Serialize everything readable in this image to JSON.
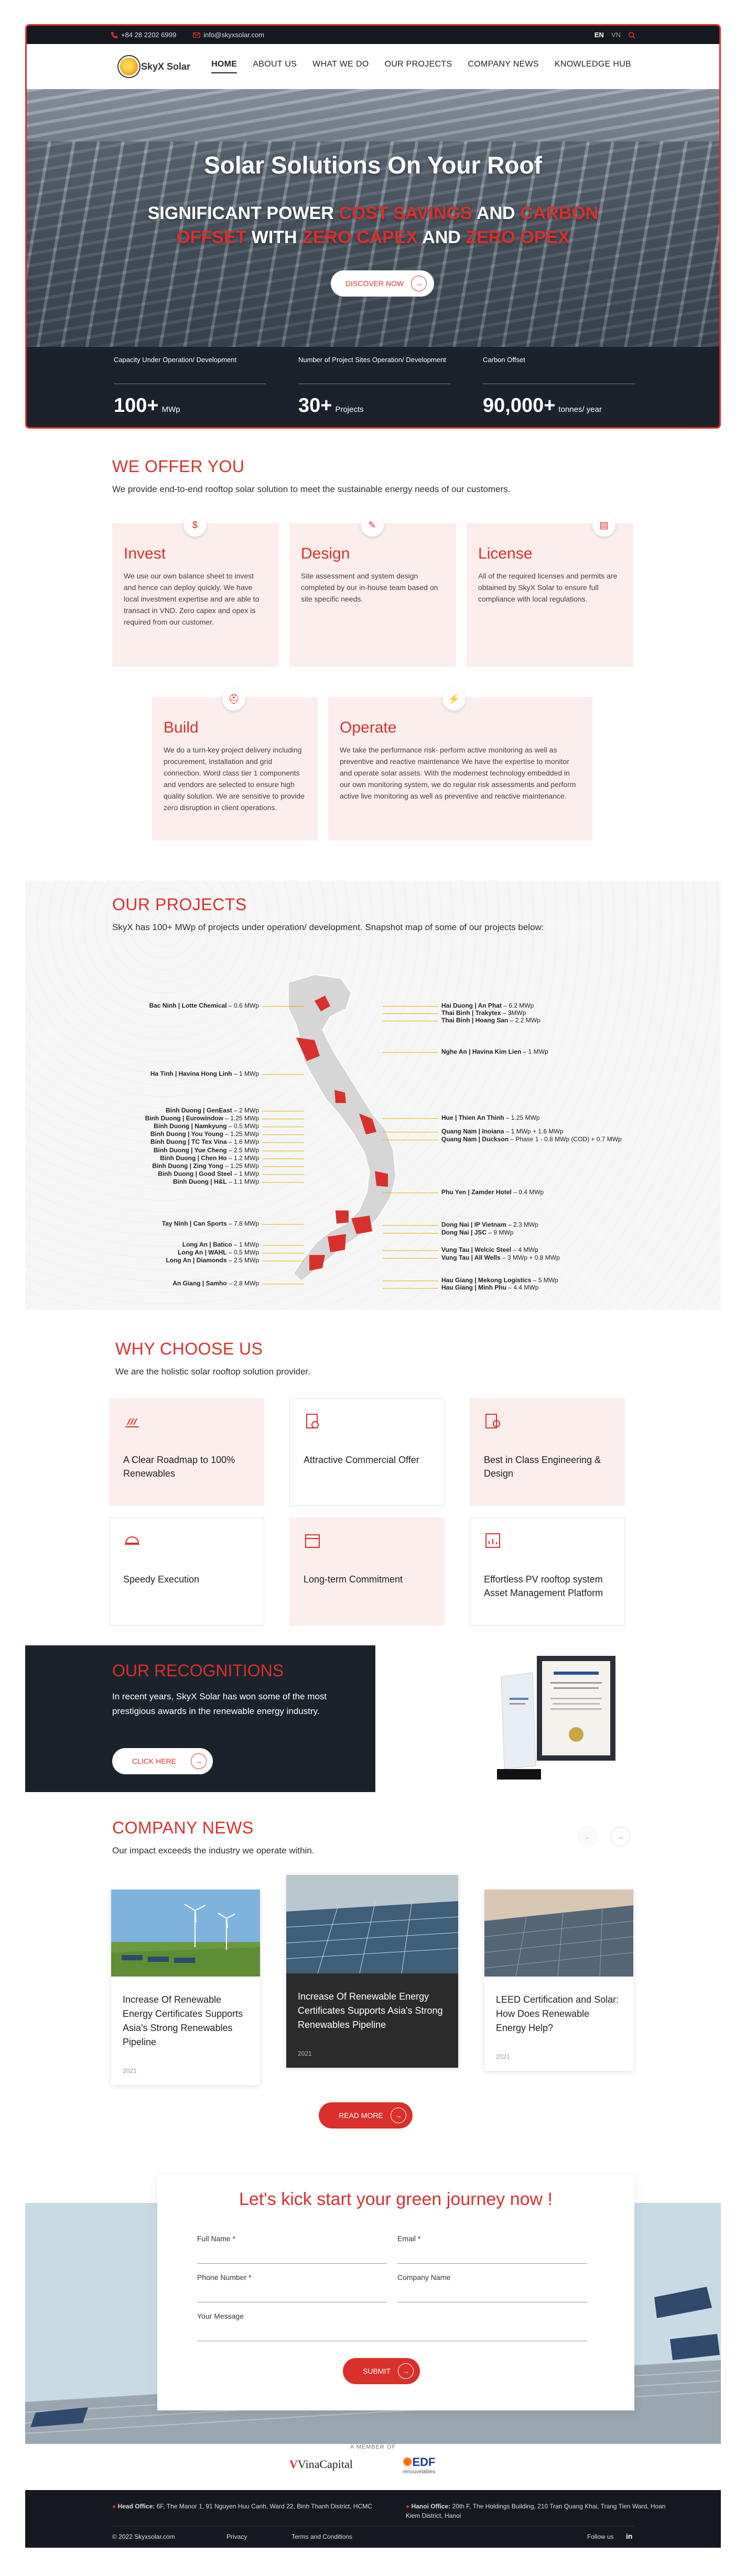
{
  "topbar": {
    "phone": "+84 28 2202 6999",
    "email": "info@skyxsolar.com",
    "lang_en": "EN",
    "lang_vn": "VN"
  },
  "brand": {
    "logo_text": "SkyX Solar"
  },
  "nav": {
    "items": [
      "HOME",
      "ABOUT US",
      "WHAT WE DO",
      "OUR PROJECTS",
      "COMPANY NEWS",
      "KNOWLEDGE HUB"
    ]
  },
  "hero": {
    "title": "Solar Solutions On Your Roof",
    "sub_1": "SIGNIFICANT POWER",
    "sub_2": "COST SAVINGS",
    "sub_3": "AND",
    "sub_4": "CARBON OFFSET",
    "sub_5": "WITH",
    "sub_6": "ZERO CAPEX",
    "sub_7": "AND",
    "sub_8": "ZERO OPEX",
    "button": "DISCOVER NOW"
  },
  "stats": [
    {
      "label": "Capacity Under Operation/ Development",
      "value": "100+",
      "unit": "MWp"
    },
    {
      "label": "Number of Project Sites Operation/ Development",
      "value": "30+",
      "unit": "Projects"
    },
    {
      "label": "Carbon Offset",
      "value": "90,000+",
      "unit": "tonnes/ year"
    }
  ],
  "offer": {
    "title": "WE OFFER YOU",
    "desc": "We provide end-to-end rooftop solar solution to meet the sustainable energy needs of our customers.",
    "cards": [
      {
        "title": "Invest",
        "text": "We use our own balance sheet to invest and hence can deploy quickly. We have local investment expertise and are able to transact in VND. Zero capex and opex is required from our customer."
      },
      {
        "title": "Design",
        "text": "Site assessment and system design completed by our in-house team based on site specific needs."
      },
      {
        "title": "License",
        "text": "All of the required licenses and permits are obtained by SkyX Solar to ensure full compliance with local regulations."
      },
      {
        "title": "Build",
        "text": "We do a turn-key project delivery including procurement, installation and grid connection. Word class tier 1 components and vendors are selected to ensure high quality solution. We are sensitive to provide zero disruption in client operations."
      },
      {
        "title": "Operate",
        "text": "We take the performance risk- perform active monitoring as well as preventive and reactive maintenance We have the expertise to monitor and operate solar assets. With the modernest technology embedded in our own monitoring system, we do regular risk assessments and perform active live monitoring as well as preventive and reactive maintenance."
      }
    ]
  },
  "projects": {
    "title": "OUR PROJECTS",
    "desc": "SkyX has 100+ MWp of projects under operation/ development. Snapshot map of some of our projects below:",
    "left": [
      {
        "site": "Bac Ninh | Lotte Chemical",
        "cap": "0.6 MWp"
      },
      {
        "site": "Ha Tinh | Havina Hong Linh",
        "cap": "1 MWp"
      },
      {
        "site": "Binh Duong | GenEast",
        "cap": "2 MWp"
      },
      {
        "site": "Binh Duong | Eurowindow",
        "cap": "1.25 MWp"
      },
      {
        "site": "Binh Duong | Namkyung",
        "cap": "0.5 MWp"
      },
      {
        "site": "Binh Duong | You Young",
        "cap": "1.25 MWp"
      },
      {
        "site": "Binh Duong | TC Tex Vina",
        "cap": "1.6 MWp"
      },
      {
        "site": "Binh Duong | Yue Cheng",
        "cap": "2.5 MWp"
      },
      {
        "site": "Binh Duong | Chen Ho",
        "cap": "1.2 MWp"
      },
      {
        "site": "Binh Duong | Zing Yong",
        "cap": "1.25 MWp"
      },
      {
        "site": "Binh Duong | Good Steel",
        "cap": "1 MWp"
      },
      {
        "site": "Binh Duong | H&L",
        "cap": "1.1 MWp"
      },
      {
        "site": "Tay Ninh | Can Sports",
        "cap": "7.8 MWp"
      },
      {
        "site": "Long An | Batico",
        "cap": "1 MWp"
      },
      {
        "site": "Long An | WAHL",
        "cap": "0.5 MWp"
      },
      {
        "site": "Long An | Diamonds",
        "cap": "2.5 MWp"
      },
      {
        "site": "An Giang | Samho",
        "cap": "2.8 MWp"
      }
    ],
    "right": [
      {
        "site": "Hai Duong | An Phat",
        "cap": "6.2 MWp"
      },
      {
        "site": "Thai Binh | Trakytex",
        "cap": "3MWp"
      },
      {
        "site": "Thai Binh | Hoang San",
        "cap": "2.2 MWp"
      },
      {
        "site": "Nghe An | Havina Kim Lien",
        "cap": "1 MWp"
      },
      {
        "site": "Hue | Thien An Thinh",
        "cap": "1.25 MWp"
      },
      {
        "site": "Quang Nam | Inoiana",
        "cap": "1 MWp + 1.6 MWp"
      },
      {
        "site": "Quang Nam | Duckson",
        "cap": "Phase 1 - 0.8 MWp (COD) + 0.7 MWp"
      },
      {
        "site": "Phu Yen | Zamder Hotel",
        "cap": "0.4 MWp"
      },
      {
        "site": "Dong Nai | IP Vietnam",
        "cap": "2.3 MWp"
      },
      {
        "site": "Dong Nai | JSC",
        "cap": "9 MWp"
      },
      {
        "site": "Vung Tau | Welcic Steel",
        "cap": "4 MWp"
      },
      {
        "site": "Vung Tau | All Wells",
        "cap": "3 MWp + 0.8 MWp"
      },
      {
        "site": "Hau Giang | Mekong Logistics",
        "cap": "5 MWp"
      },
      {
        "site": "Hau Giang | Minh Phu",
        "cap": "4.4 MWp"
      }
    ]
  },
  "why": {
    "title": "WHY CHOOSE US",
    "desc": "We are the holistic solar rooftop solution provider.",
    "items": [
      "A Clear Roadmap to 100% Renewables",
      "Attractive Commercial Offer",
      "Best in Class Engineering & Design",
      "Speedy Execution",
      "Long-term Commitment",
      "Effortless PV rooftop system Asset Management Platform"
    ]
  },
  "recog": {
    "title": "OUR RECOGNITIONS",
    "desc": "In recent years, SkyX Solar has won some of the most prestigious awards in the renewable energy industry.",
    "button": "CLICK HERE"
  },
  "news": {
    "title": "COMPANY NEWS",
    "desc": "Our impact exceeds the industry we operate within.",
    "items": [
      {
        "title": "Increase Of Renewable Energy Certificates Supports Asia's Strong Renewables Pipeline",
        "date": "2021"
      },
      {
        "title": "Increase Of Renewable Energy Certificates Supports Asia's Strong Renewables Pipeline",
        "date": "2021"
      },
      {
        "title": "LEED Certification and Solar: How Does Renewable Energy Help?",
        "date": "2021"
      }
    ],
    "button": "READ MORE"
  },
  "contact": {
    "title": "Let's kick start your green journey now !",
    "full_name": "Full Name *",
    "email": "Email *",
    "phone": "Phone Number *",
    "company": "Company Name",
    "message": "Your Message",
    "submit": "SUBMIT"
  },
  "member": {
    "label": "A MEMBER OF",
    "vinacapital": "VinaCapital",
    "edf": "EDF",
    "edf_sub": "renouvelables"
  },
  "footer": {
    "head_label": "Head Office:",
    "head_addr": "6F, The Manor 1, 91 Nguyen Huu Canh, Ward 22, Binh Thanh District, HCMC",
    "hanoi_label": "Hanoi Office:",
    "hanoi_addr": "20th F, The Holdings Building, 210 Tran Quang Khai, Trang Tien Ward, Hoan Kiem District, Hanoi",
    "copy": "© 2022 Skyxsolar.com",
    "privacy": "Privacy",
    "terms": "Terms and Conditions",
    "follow": "Follow us",
    "social": "in"
  },
  "colors": {
    "accent": "#d9302b",
    "dark": "#1c222b",
    "pink": "#fbeeed"
  }
}
